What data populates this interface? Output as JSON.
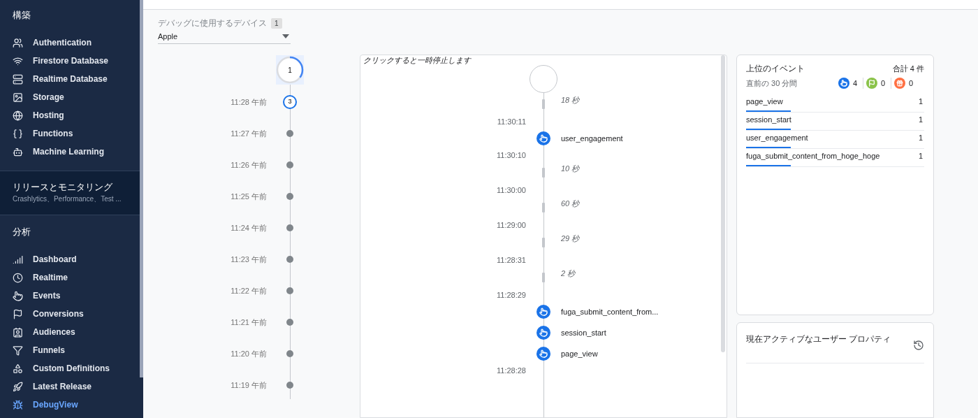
{
  "sidebar": {
    "sections": [
      {
        "kind": "group",
        "title": "構築",
        "items": [
          {
            "label": "Authentication",
            "selected": false
          },
          {
            "label": "Firestore Database",
            "selected": false
          },
          {
            "label": "Realtime Database",
            "selected": false
          },
          {
            "label": "Storage",
            "selected": false
          },
          {
            "label": "Hosting",
            "selected": false
          },
          {
            "label": "Functions",
            "selected": false
          },
          {
            "label": "Machine Learning",
            "selected": false
          }
        ]
      },
      {
        "kind": "collapsed",
        "title": "リリースとモニタリング",
        "subtitle": "Crashlytics、Performance、Test ..."
      },
      {
        "kind": "group",
        "title": "分析",
        "items": [
          {
            "label": "Dashboard",
            "selected": false
          },
          {
            "label": "Realtime",
            "selected": false
          },
          {
            "label": "Events",
            "selected": false
          },
          {
            "label": "Conversions",
            "selected": false
          },
          {
            "label": "Audiences",
            "selected": false
          },
          {
            "label": "Funnels",
            "selected": false
          },
          {
            "label": "Custom Definitions",
            "selected": false
          },
          {
            "label": "Latest Release",
            "selected": false
          },
          {
            "label": "DebugView",
            "selected": true
          }
        ]
      }
    ]
  },
  "device_picker": {
    "label": "デバッグに使用するデバイス",
    "count": "1",
    "value": "Apple"
  },
  "minutes": {
    "current": {
      "count": "1"
    },
    "rows": [
      {
        "time": "11:28 午前",
        "count": "3"
      },
      {
        "time": "11:27 午前"
      },
      {
        "time": "11:26 午前"
      },
      {
        "time": "11:25 午前"
      },
      {
        "time": "11:24 午前"
      },
      {
        "time": "11:23 午前"
      },
      {
        "time": "11:22 午前"
      },
      {
        "time": "11:21 午前"
      },
      {
        "time": "11:20 午前"
      },
      {
        "time": "11:19 午前"
      }
    ]
  },
  "stream": {
    "hint": "クリックすると一時停止します",
    "items": [
      {
        "kind": "gap",
        "label": "18 秒"
      },
      {
        "kind": "time",
        "label": "11:30:11"
      },
      {
        "kind": "event",
        "label": "user_engagement"
      },
      {
        "kind": "time",
        "label": "11:30:10"
      },
      {
        "kind": "gap",
        "label": "10 秒"
      },
      {
        "kind": "time",
        "label": "11:30:00"
      },
      {
        "kind": "gap",
        "label": "60 秒"
      },
      {
        "kind": "time",
        "label": "11:29:00"
      },
      {
        "kind": "gap",
        "label": "29 秒"
      },
      {
        "kind": "time",
        "label": "11:28:31"
      },
      {
        "kind": "gap",
        "label": "2 秒"
      },
      {
        "kind": "time",
        "label": "11:28:29"
      },
      {
        "kind": "event",
        "label": "fuga_submit_content_from..."
      },
      {
        "kind": "event",
        "label": "session_start"
      },
      {
        "kind": "event",
        "label": "page_view"
      },
      {
        "kind": "time",
        "label": "11:28:28"
      }
    ]
  },
  "top_events": {
    "title": "上位のイベント",
    "total": "合計 4 件",
    "period": "直前の 30 分間",
    "counters": [
      {
        "kind": "events",
        "count": "4",
        "color": "#1a73e8"
      },
      {
        "kind": "conversions",
        "count": "0",
        "color": "#8bc34a"
      },
      {
        "kind": "errors",
        "count": "0",
        "color": "#ff7043"
      }
    ],
    "rows": [
      {
        "name": "page_view",
        "count": "1"
      },
      {
        "name": "session_start",
        "count": "1"
      },
      {
        "name": "user_engagement",
        "count": "1"
      },
      {
        "name": "fuga_submit_content_from_hoge_hoge",
        "count": "1"
      }
    ]
  },
  "user_properties": {
    "title": "現在アクティブなユーザー プロパティ"
  }
}
